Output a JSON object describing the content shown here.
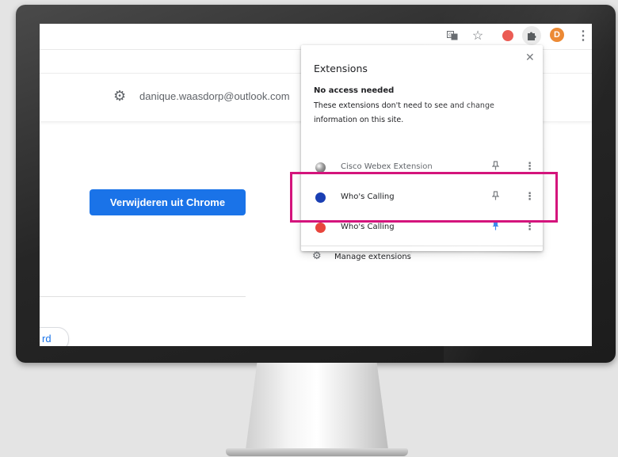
{
  "toolbar": {
    "translate_icon": "translate-icon",
    "star_icon": "star-icon",
    "extension_icon": "whos-calling-icon",
    "puzzle_icon": "puzzle-icon",
    "avatar_letter": "D",
    "menu_icon": "kebab-menu-icon"
  },
  "page": {
    "account_email": "danique.waasdorp@outlook.com",
    "remove_button_label": "Verwijderen uit Chrome",
    "bottom_pill_text": "rd"
  },
  "extensions_popup": {
    "title": "Extensions",
    "section_heading": "No access needed",
    "section_description": "These extensions don't need to see and change information on this site.",
    "items": [
      {
        "name": "Cisco Webex Extension",
        "pinned": false
      },
      {
        "name": "Who's Calling",
        "pinned": false
      },
      {
        "name": "Who's Calling",
        "pinned": true
      }
    ],
    "manage_label": "Manage extensions"
  },
  "colors": {
    "accent_blue": "#1a73e8",
    "highlight_frame": "#d4147c",
    "avatar_orange": "#e8710a",
    "whos_calling_red": "#e8453c"
  }
}
